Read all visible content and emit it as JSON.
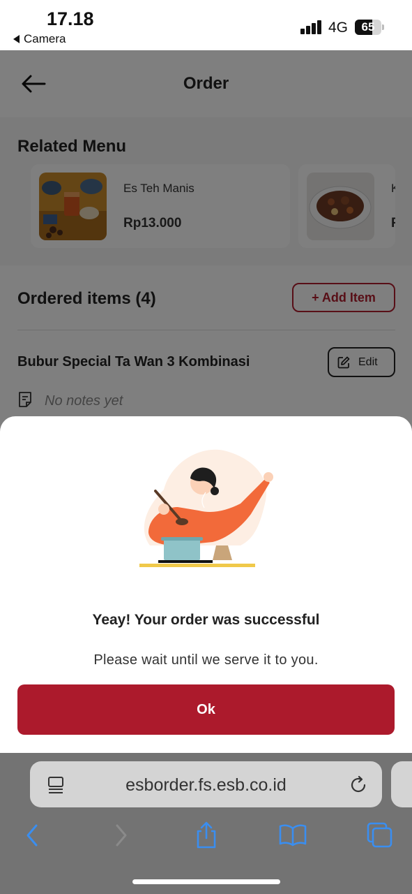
{
  "status_bar": {
    "time": "17.18",
    "back_app": "Camera",
    "network": "4G",
    "battery_percent": 65
  },
  "header": {
    "title": "Order"
  },
  "related_menu": {
    "title": "Related Menu",
    "items": [
      {
        "name": "Es Teh Manis",
        "price": "Rp13.000"
      },
      {
        "name": "K",
        "price": "R"
      }
    ]
  },
  "ordered": {
    "title": "Ordered items (4)",
    "add_item_label": "+ Add Item",
    "items": [
      {
        "name": "Bubur Special Ta Wan 3 Kombinasi",
        "edit_label": "Edit",
        "notes": "No notes yet"
      }
    ]
  },
  "dialog": {
    "title": "Yeay! Your order was successful",
    "message": "Please wait until we serve it to you.",
    "ok_label": "Ok",
    "accent_color": "#ac1a2c"
  },
  "browser": {
    "url": "esborder.fs.esb.co.id"
  }
}
